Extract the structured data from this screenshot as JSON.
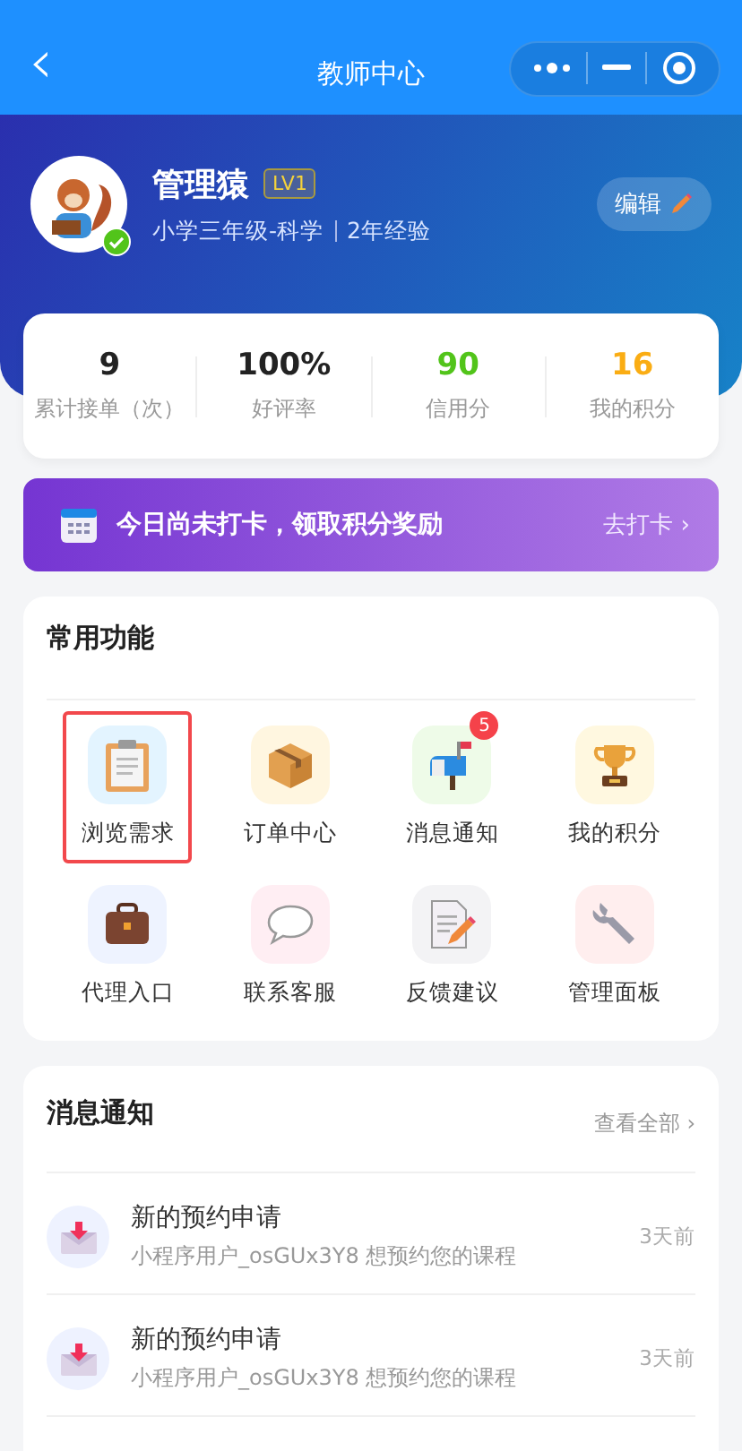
{
  "nav": {
    "back": "‹",
    "title": "教师中心"
  },
  "profile": {
    "name": "管理猿",
    "level_badge": "LV1",
    "verified": true,
    "subtitle": "小学三年级-科学",
    "experience": "2年经验",
    "edit": "编辑"
  },
  "stats": [
    {
      "value": "9",
      "label": "累计接单（次）",
      "color": "#222222"
    },
    {
      "value": "100%",
      "label": "好评率",
      "color": "#222222"
    },
    {
      "value": "90",
      "label": "信用分",
      "color": "#52c41a"
    },
    {
      "value": "16",
      "label": "我的积分",
      "color": "#faad14"
    }
  ],
  "checkin": {
    "text": "今日尚未打卡，领取积分奖励",
    "action": "去打卡 ›"
  },
  "functions": {
    "title": "常用功能",
    "items": [
      {
        "label": "浏览需求",
        "highlighted": true
      },
      {
        "label": "订单中心",
        "highlighted": false
      },
      {
        "label": "消息通知",
        "highlighted": false,
        "badge": "5"
      },
      {
        "label": "我的积分",
        "highlighted": false
      },
      {
        "label": "代理入口",
        "highlighted": false
      },
      {
        "label": "联系客服",
        "highlighted": false
      },
      {
        "label": "反馈建议",
        "highlighted": false
      },
      {
        "label": "管理面板",
        "highlighted": false
      }
    ]
  },
  "messages": {
    "title": "消息通知",
    "view_all": "查看全部 ›",
    "items": [
      {
        "title": "新的预约申请",
        "body": "小程序用户_osGUx3Y8 想预约您的课程",
        "time": "3天前"
      },
      {
        "title": "新的预约申请",
        "body": "小程序用户_osGUx3Y8 想预约您的课程",
        "time": "3天前"
      }
    ]
  }
}
